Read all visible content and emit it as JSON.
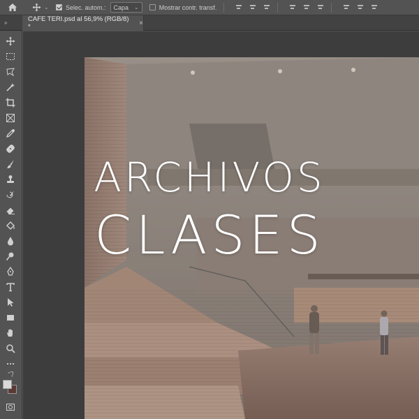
{
  "options_bar": {
    "auto_select_label": "Selec. autom.:",
    "auto_select_checked": true,
    "layer_select_value": "Capa",
    "show_transform_label": "Mostrar contr. transf.",
    "show_transform_checked": false
  },
  "document": {
    "tab_title": "CAFE TERI.psd al 56,9% (RGB/8) *",
    "close_glyph": "×"
  },
  "overlay": {
    "line1": "ARCHIVOS",
    "line2": "CLASES"
  },
  "colors": {
    "foreground": "#d9d9d9",
    "background": "#5a3a33",
    "ui_panel": "#535353",
    "canvas_bg": "#3d3d3d"
  },
  "tools": [
    "move-tool",
    "marquee-tool",
    "lasso-tool",
    "magic-wand-tool",
    "crop-tool",
    "frame-tool",
    "eyedropper-tool",
    "healing-brush-tool",
    "brush-tool",
    "clone-stamp-tool",
    "history-brush-tool",
    "eraser-tool",
    "paint-bucket-tool",
    "blur-tool",
    "dodge-tool",
    "pen-tool",
    "type-tool",
    "path-selection-tool",
    "rectangle-tool",
    "hand-tool",
    "zoom-tool",
    "more-tools",
    "quick-mask"
  ]
}
